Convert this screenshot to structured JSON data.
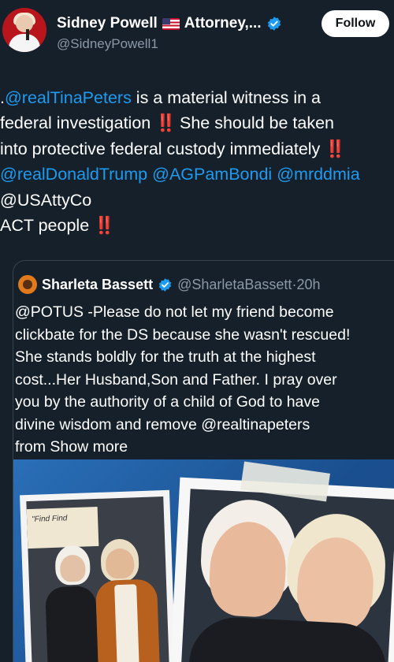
{
  "author": {
    "display_name": "Sidney Powell",
    "title_suffix": "Attorney,...",
    "handle": "@SidneyPowell1",
    "flag_icon": "us-flag-icon",
    "verified_icon": "verified-badge-icon",
    "follow_label": "Follow"
  },
  "tweet": {
    "l1_pre": ".",
    "l1_mention": "@realTinaPeters",
    "l1_post": " is a material witness in a",
    "l2_text": "federal investigation ",
    "l2_bang": "‼️",
    "l2_post": " She should be taken",
    "l3_text": "into protective federal custody immediately ",
    "l3_bang": "‼️",
    "l4_m1": "@realDonaldTrump",
    "l4_m2": "@AGPamBondi",
    "l4_m3": "@mrddmia",
    "l5_text": "@USAttyCo",
    "l6_text": "ACT people ",
    "l6_bang": "‼️"
  },
  "quote": {
    "display_name": "Sharleta Bassett",
    "handle": "@SharletaBassett",
    "separator": " · ",
    "time": "20h",
    "lines": [
      "@POTUS -Please do not let my friend become",
      "clickbate for the DS because she wasn't rescued!",
      "She stands boldly for the truth at the highest",
      "cost...Her Husband,Son and Father. I pray over",
      "you by the authority of a child of God to have",
      "divine wisdom and remove @realtinapeters"
    ],
    "last_line_pre": "from ",
    "show_more": "Show more",
    "photo_sign_text": "\"Find\nFind"
  },
  "colors": {
    "background": "#15202b",
    "link": "#1d9bf0",
    "secondary_text": "#8b98a5",
    "alert": "#f4212e",
    "border": "#38444d"
  }
}
